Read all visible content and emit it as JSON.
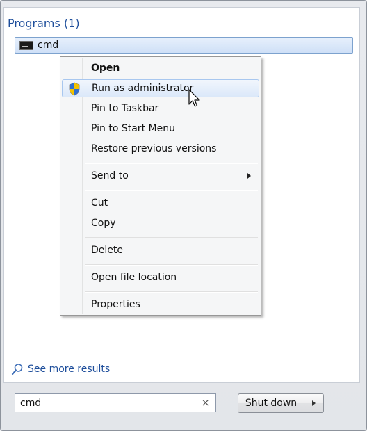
{
  "results": {
    "group_title": "Programs (1)",
    "item_label": "cmd",
    "see_more": "See more results"
  },
  "context_menu": {
    "items": [
      {
        "label": "Open"
      },
      {
        "label": "Run as administrator"
      },
      {
        "label": "Pin to Taskbar"
      },
      {
        "label": "Pin to Start Menu"
      },
      {
        "label": "Restore previous versions"
      },
      {
        "label": "Send to"
      },
      {
        "label": "Cut"
      },
      {
        "label": "Copy"
      },
      {
        "label": "Delete"
      },
      {
        "label": "Open file location"
      },
      {
        "label": "Properties"
      }
    ]
  },
  "search": {
    "value": "cmd",
    "clear_glyph": "×"
  },
  "shutdown": {
    "label": "Shut down"
  },
  "icons": {
    "program": "command-prompt-icon",
    "run_as_admin": "uac-shield-icon",
    "see_more": "magnifier-icon"
  },
  "colors": {
    "link_blue": "#1e4e9b",
    "selection_border": "#7da2ce"
  }
}
